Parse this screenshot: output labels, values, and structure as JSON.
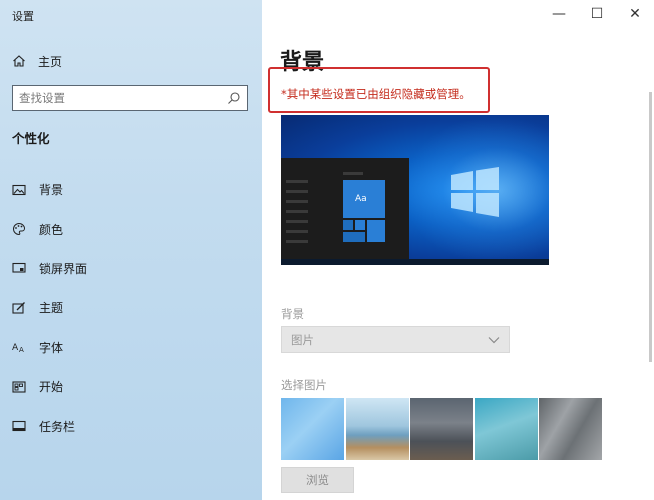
{
  "window": {
    "title": "设置",
    "minimize": "—",
    "maximize": "☐",
    "close": "✕"
  },
  "sidebar": {
    "home_label": "主页",
    "search_placeholder": "查找设置",
    "section_title": "个性化",
    "items": [
      {
        "label": "背景",
        "icon": "picture-icon"
      },
      {
        "label": "颜色",
        "icon": "palette-icon"
      },
      {
        "label": "锁屏界面",
        "icon": "lockscreen-icon"
      },
      {
        "label": "主题",
        "icon": "theme-icon"
      },
      {
        "label": "字体",
        "icon": "font-icon"
      },
      {
        "label": "开始",
        "icon": "start-icon"
      },
      {
        "label": "任务栏",
        "icon": "taskbar-icon"
      }
    ]
  },
  "main": {
    "title": "背景",
    "notice": "*其中某些设置已由组织隐藏或管理。",
    "preview_tile_text": "Aa",
    "background_label": "背景",
    "background_value": "图片",
    "choose_picture_label": "选择图片",
    "browse_label": "浏览"
  },
  "colors": {
    "notice_text": "#c42b1c",
    "notice_border": "#d03030",
    "sidebar_bg": "#c3dcef"
  }
}
